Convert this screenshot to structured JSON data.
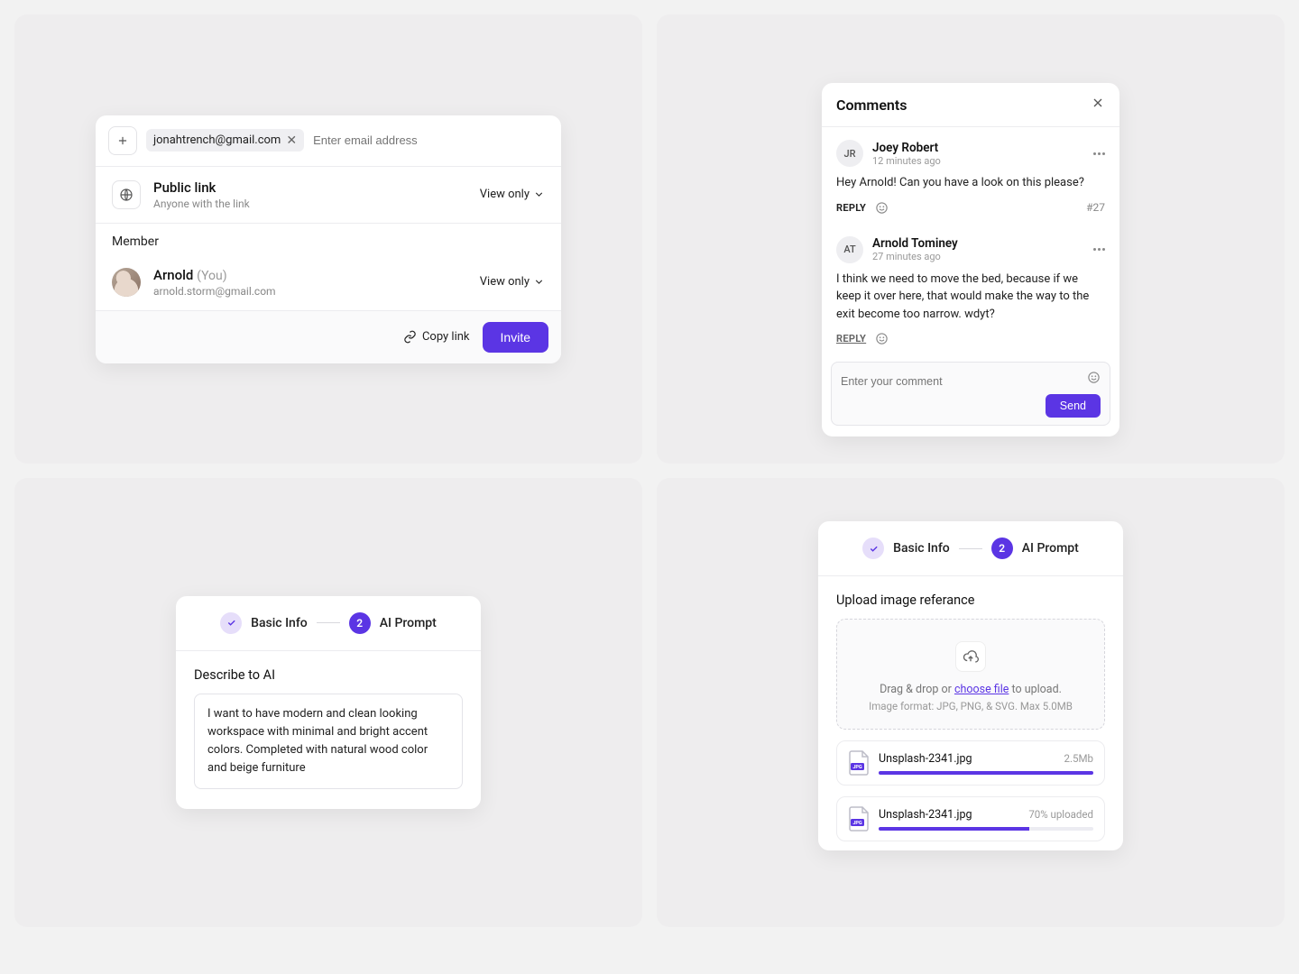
{
  "share": {
    "email_chip": "jonahtrench@gmail.com",
    "email_placeholder": "Enter email address",
    "public_link_title": "Public link",
    "public_link_sub": "Anyone with the link",
    "public_link_perm": "View only",
    "member_heading": "Member",
    "member_name": "Arnold",
    "member_you": "(You)",
    "member_email": "arnold.storm@gmail.com",
    "member_perm": "View only",
    "copy_link": "Copy link",
    "invite": "Invite"
  },
  "comments": {
    "title": "Comments",
    "input_placeholder": "Enter your comment",
    "send": "Send",
    "items": [
      {
        "initials": "JR",
        "name": "Joey Robert",
        "time": "12 minutes ago",
        "body": "Hey Arnold! Can you have a look on this please?",
        "reply": "REPLY",
        "num": "#27"
      },
      {
        "initials": "AT",
        "name": "Arnold Tominey",
        "time": "27 minutes ago",
        "body": "I think we need to move the bed, because if we keep it over here, that would make the way to the exit become too narrow. wdyt?",
        "reply": "REPLY"
      }
    ]
  },
  "stepper": {
    "step1": "Basic Info",
    "step2_num": "2",
    "step2": "AI Prompt"
  },
  "describe": {
    "title": "Describe to AI",
    "text": "I want to have modern and clean looking workspace with minimal and bright accent colors. Completed with natural wood color and beige furniture"
  },
  "upload": {
    "title": "Upload image referance",
    "dz_prefix": "Drag & drop or ",
    "dz_link": "choose file",
    "dz_suffix": " to upload.",
    "dz_sub": "Image format: JPG, PNG, & SVG. Max 5.0MB",
    "files": [
      {
        "name": "Unsplash-2341.jpg",
        "meta": "2.5Mb",
        "progress": 100
      },
      {
        "name": "Unsplash-2341.jpg",
        "meta": "70% uploaded",
        "progress": 70
      }
    ]
  }
}
